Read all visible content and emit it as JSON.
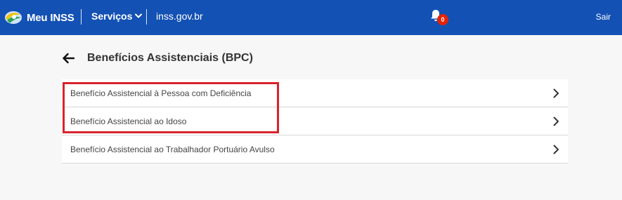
{
  "header": {
    "brand_name": "Meu INSS",
    "services_label": "Serviços",
    "site_link": "inss.gov.br",
    "notifications_count": "0",
    "logout_label": "Sair"
  },
  "page": {
    "title": "Benefícios Assistenciais (BPC)"
  },
  "benefits": [
    {
      "label": "Benefício Assistencial à Pessoa com Deficiência"
    },
    {
      "label": "Benefício Assistencial ao Idoso"
    },
    {
      "label": "Benefício Assistencial ao Trabalhador Portuário Avulso"
    }
  ],
  "colors": {
    "header_bg": "#1351b4",
    "highlight": "#d9232d",
    "badge": "#e52207"
  }
}
